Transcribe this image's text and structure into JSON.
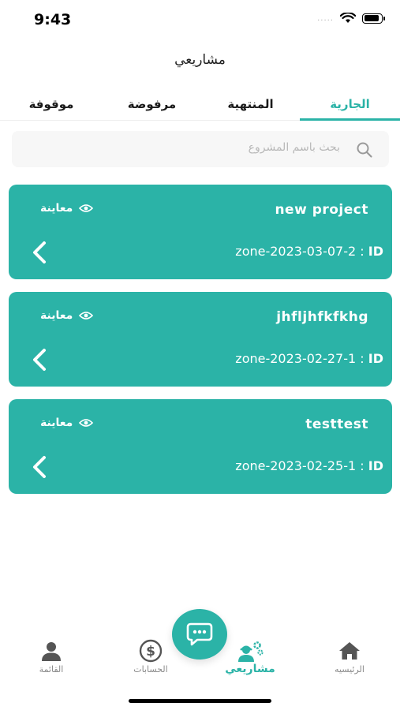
{
  "status_bar": {
    "time": "9:43",
    "signal_dots": "....."
  },
  "header": {
    "title": "مشاريعي"
  },
  "tabs": [
    {
      "label": "الجارية",
      "active": true
    },
    {
      "label": "المنتهية",
      "active": false
    },
    {
      "label": "مرفوضة",
      "active": false
    },
    {
      "label": "موقوفة",
      "active": false
    }
  ],
  "search": {
    "placeholder": "بحث باسم المشروع"
  },
  "projects": [
    {
      "title": "new project",
      "preview_label": "معاينة",
      "id_label": "ID",
      "id_separator": ":",
      "id_value": "zone-2023-03-07-2"
    },
    {
      "title": "jhfljhfkfkhg",
      "preview_label": "معاينة",
      "id_label": "ID",
      "id_separator": ":",
      "id_value": "zone-2023-02-27-1"
    },
    {
      "title": "testtest",
      "preview_label": "معاينة",
      "id_label": "ID",
      "id_separator": ":",
      "id_value": "zone-2023-02-25-1"
    }
  ],
  "bottom_nav": [
    {
      "label": "الرئيسيه",
      "icon": "home-icon",
      "active": false
    },
    {
      "label": "مشاريعي",
      "icon": "projects-icon",
      "active": true
    },
    {
      "label": "الحسابات",
      "icon": "dollar-icon",
      "active": false
    },
    {
      "label": "القائمة",
      "icon": "person-icon",
      "active": false
    }
  ],
  "fab": {
    "icon": "chat-icon"
  },
  "colors": {
    "accent": "#2bb3a7",
    "inactive": "#8a8a8a",
    "search_bg": "#f7f7f7"
  }
}
